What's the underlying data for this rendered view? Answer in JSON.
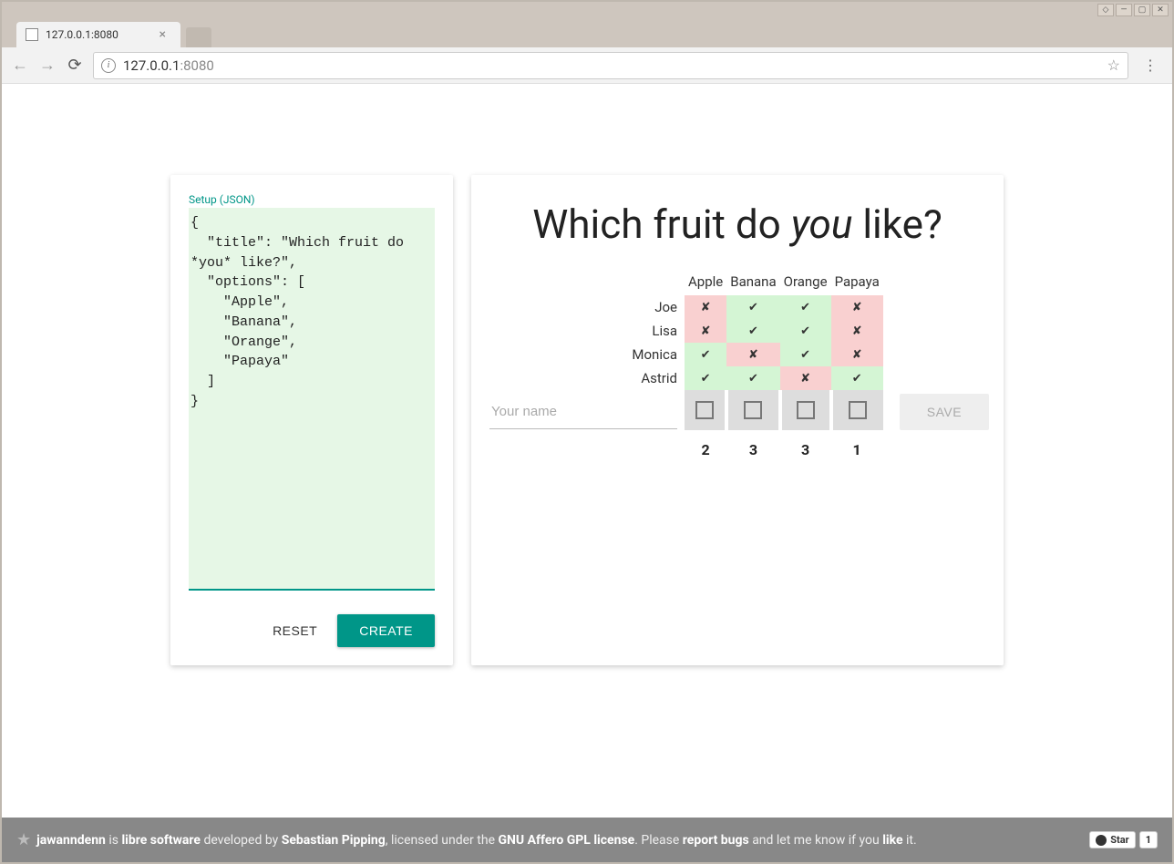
{
  "window": {
    "tab_title": "127.0.0.1:8080",
    "url_host": "127.0.0.1",
    "url_port": ":8080"
  },
  "setup": {
    "label": "Setup (JSON)",
    "json": "{\n  \"title\": \"Which fruit do *you* like?\",\n  \"options\": [\n    \"Apple\",\n    \"Banana\",\n    \"Orange\",\n    \"Papaya\"\n  ]\n}",
    "reset_label": "RESET",
    "create_label": "CREATE"
  },
  "poll": {
    "title_pre": "Which fruit do ",
    "title_em": "you",
    "title_post": " like?",
    "options": [
      "Apple",
      "Banana",
      "Orange",
      "Papaya"
    ],
    "votes": [
      {
        "name": "Joe",
        "cells": [
          "no",
          "yes",
          "yes",
          "no"
        ]
      },
      {
        "name": "Lisa",
        "cells": [
          "no",
          "yes",
          "yes",
          "no"
        ]
      },
      {
        "name": "Monica",
        "cells": [
          "yes",
          "no",
          "yes",
          "no"
        ]
      },
      {
        "name": "Astrid",
        "cells": [
          "yes",
          "yes",
          "no",
          "yes"
        ]
      }
    ],
    "totals": [
      "2",
      "3",
      "3",
      "1"
    ],
    "name_placeholder": "Your name",
    "save_label": "SAVE"
  },
  "footer": {
    "app": "jawanndenn",
    "t1": " is ",
    "libre": "libre software",
    "t2": " developed by ",
    "author": "Sebastian Pipping",
    "t3": ", licensed under the ",
    "license": "GNU Affero GPL license",
    "t4": ". Please ",
    "bugs": "report bugs",
    "t5": " and let me know if you ",
    "like": "like",
    "t6": " it.",
    "star_label": "Star",
    "star_count": "1"
  }
}
